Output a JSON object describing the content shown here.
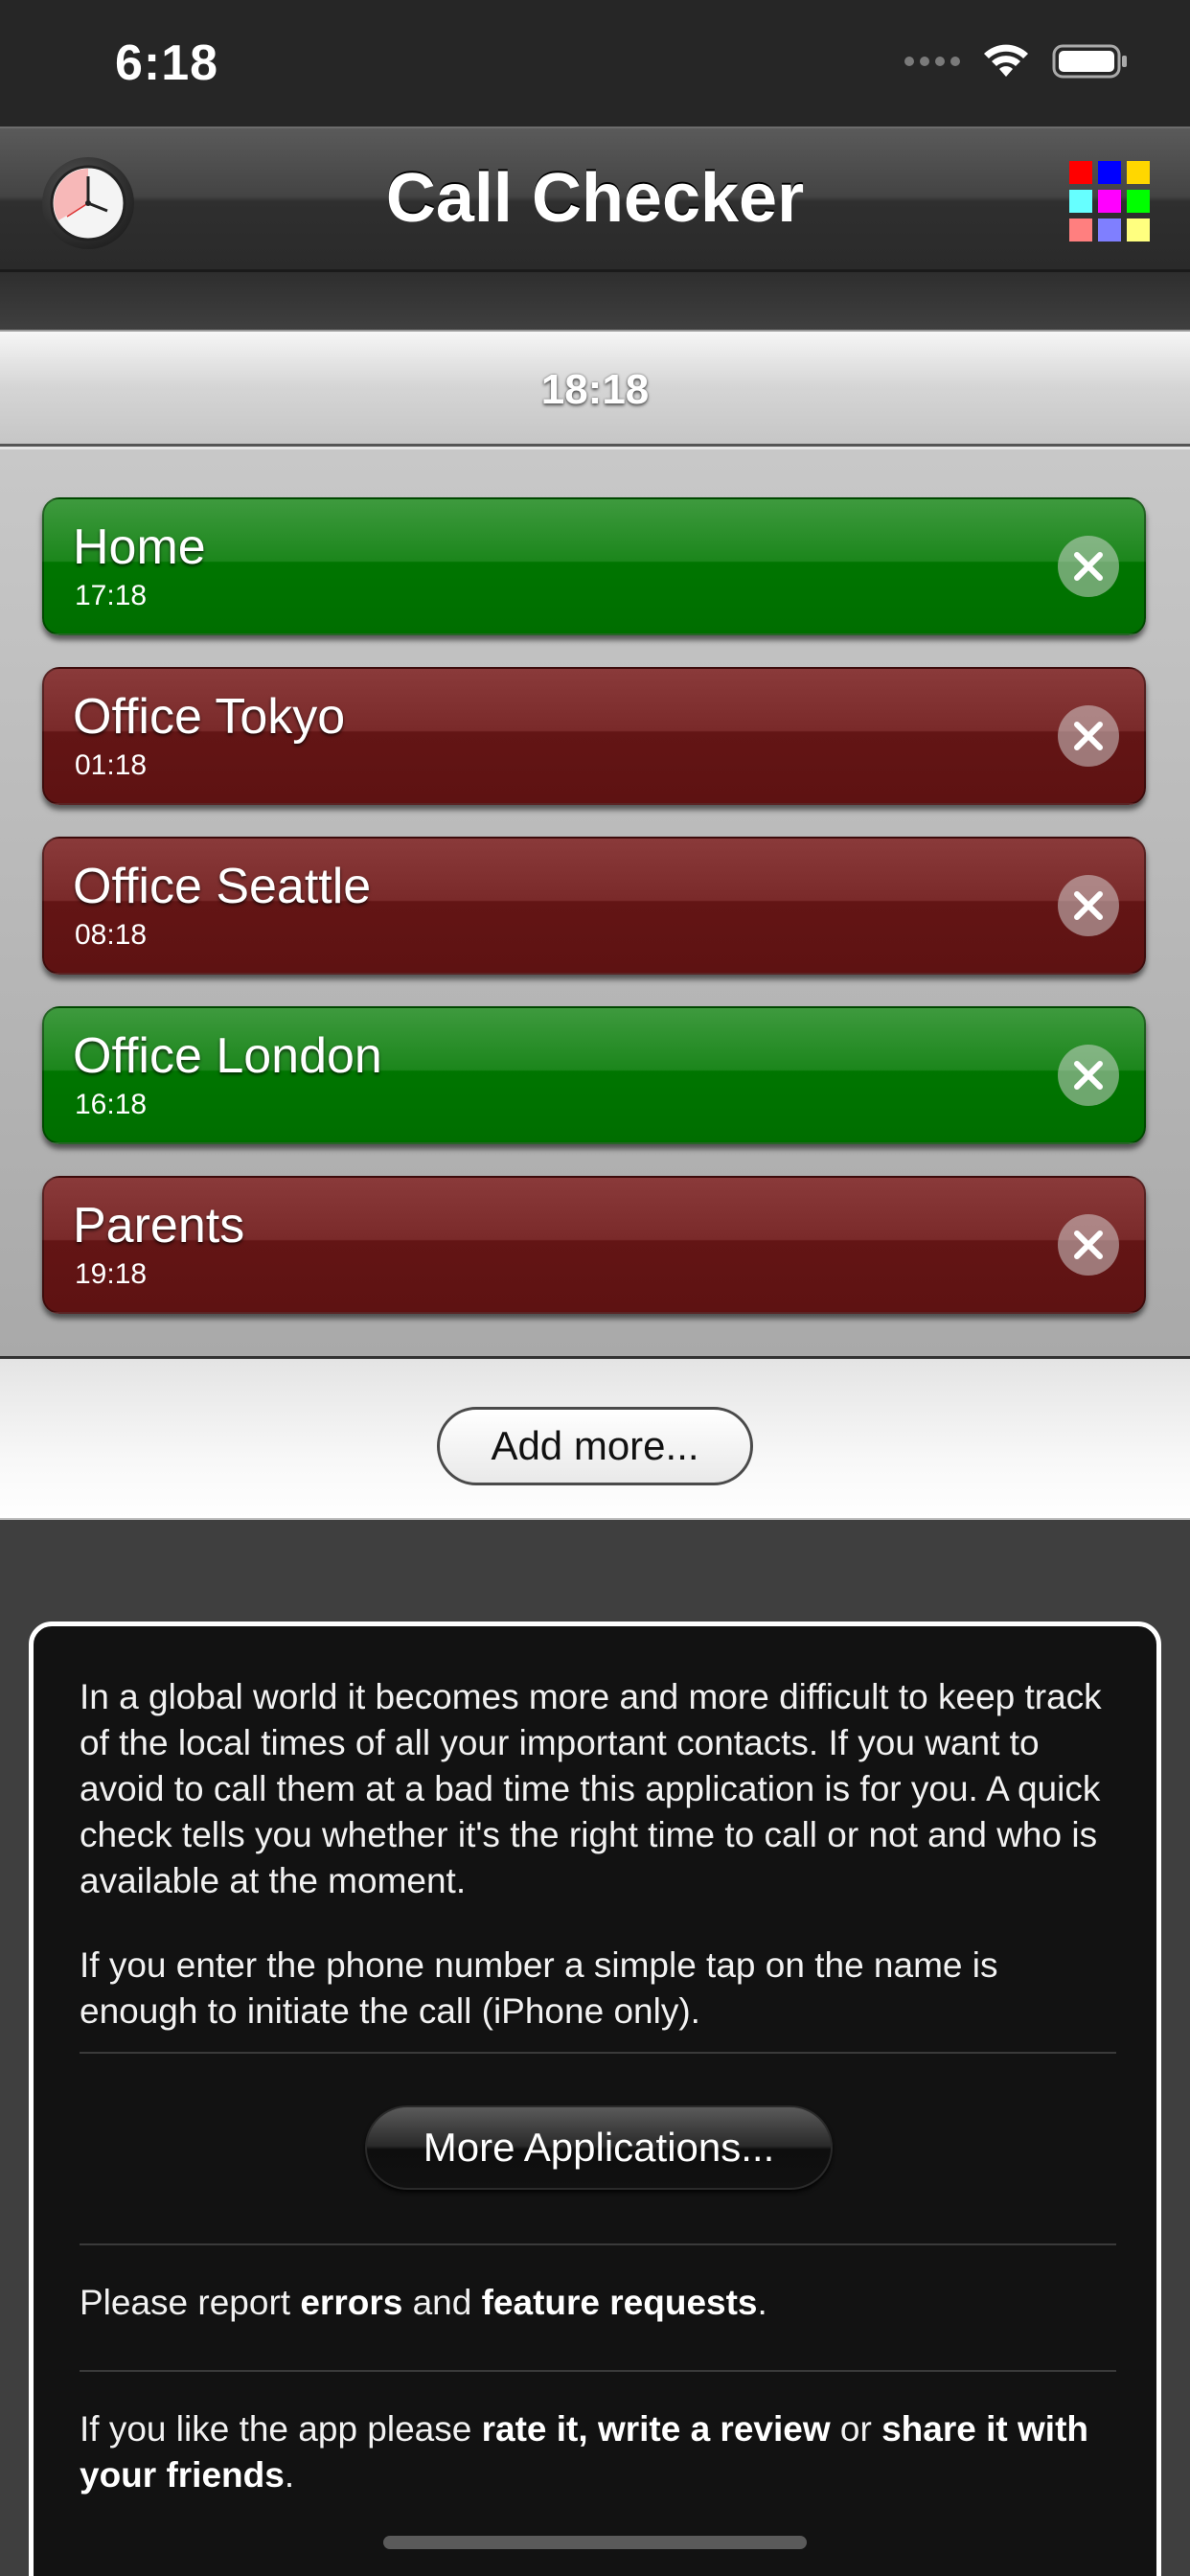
{
  "status_bar": {
    "time": "6:18"
  },
  "nav": {
    "title": "Call Checker",
    "grid_colors": [
      "#ff0000",
      "#0000ff",
      "#ffd700",
      "#66ffff",
      "#ff00ff",
      "#00ff00",
      "#ff7f7f",
      "#7f7fff",
      "#ffff7f"
    ]
  },
  "current_time": "18:18",
  "contacts": [
    {
      "name": "Home",
      "time": "17:18",
      "status": "green"
    },
    {
      "name": "Office Tokyo",
      "time": "01:18",
      "status": "red"
    },
    {
      "name": "Office Seattle",
      "time": "08:18",
      "status": "red"
    },
    {
      "name": "Office London",
      "time": "16:18",
      "status": "green"
    },
    {
      "name": "Parents",
      "time": "19:18",
      "status": "red"
    }
  ],
  "add_more_label": "Add more...",
  "info": {
    "paragraph1": "In a global world it becomes more and more difficult to keep track of the local times of all your important contacts. If you want to avoid to call them at a bad time this application is for you. A quick check tells you whether it's the right time to call or not and who is available at the moment.",
    "paragraph2": "If you enter the phone number a simple tap on the name is enough to initiate the call (iPhone only).",
    "more_apps_label": "More Applications...",
    "report": {
      "prefix": "Please report ",
      "errors": "errors",
      "and": " and ",
      "feature_requests": "feature requests",
      "suffix": "."
    },
    "rate": {
      "prefix": "If you like the app please ",
      "rate_review": "rate it, write a review",
      "or": " or ",
      "share": "share it with your friends",
      "suffix": "."
    }
  },
  "colors": {
    "green": "#007500",
    "red": "#631515"
  }
}
